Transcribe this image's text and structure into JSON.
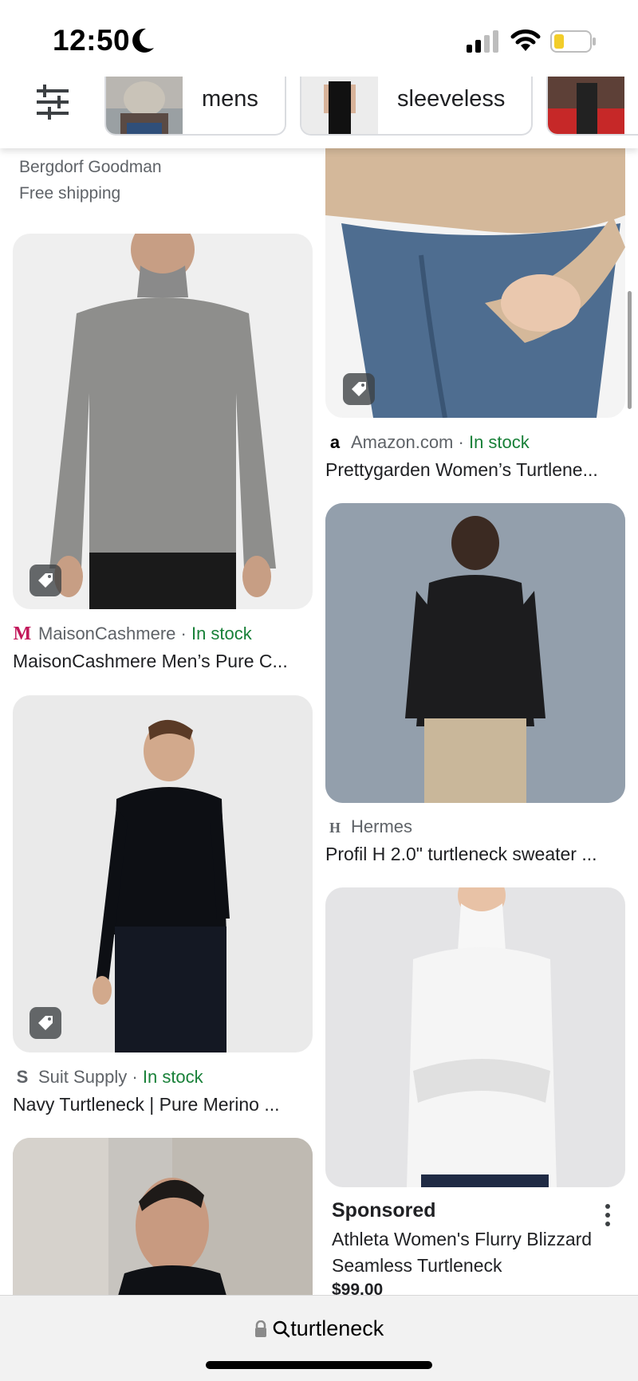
{
  "status": {
    "time": "12:50"
  },
  "chips": [
    {
      "label": "mens"
    },
    {
      "label": "sleeveless"
    },
    {
      "label": ""
    }
  ],
  "top_left": {
    "store": "Bergdorf Goodman",
    "shipping": "Free shipping"
  },
  "left_column": [
    {
      "source": "MaisonCashmere",
      "stock": "In stock",
      "separator": " · ",
      "title": "MaisonCashmere Men’s Pure C...",
      "logo": "M"
    },
    {
      "source": "Suit Supply",
      "stock": "In stock",
      "separator": " · ",
      "title": "Navy Turtleneck | Pure Merino ...",
      "logo": "S"
    }
  ],
  "right_column": [
    {
      "source": "Amazon.com",
      "stock": "In stock",
      "separator": " · ",
      "title": "Prettygarden Women’s Turtlene...",
      "logo": "a"
    },
    {
      "source": "Hermes",
      "stock": "",
      "separator": "",
      "title": "Profil H 2.0\" turtleneck sweater ...",
      "logo": "H"
    }
  ],
  "sponsored": {
    "label": "Sponsored",
    "title": "Athleta Women's Flurry Blizzard Seamless Turtleneck",
    "price": "$99.00"
  },
  "address_bar": {
    "query": "turtleneck"
  },
  "colors": {
    "in_stock": "#188038",
    "text_secondary": "#5f6368",
    "accent_logo_m": "#c2185b"
  },
  "icons": [
    "moon-icon",
    "signal-icon",
    "wifi-icon",
    "battery-icon",
    "filter-icon",
    "tag-icon",
    "more-vert-icon",
    "lock-icon",
    "search-icon"
  ]
}
